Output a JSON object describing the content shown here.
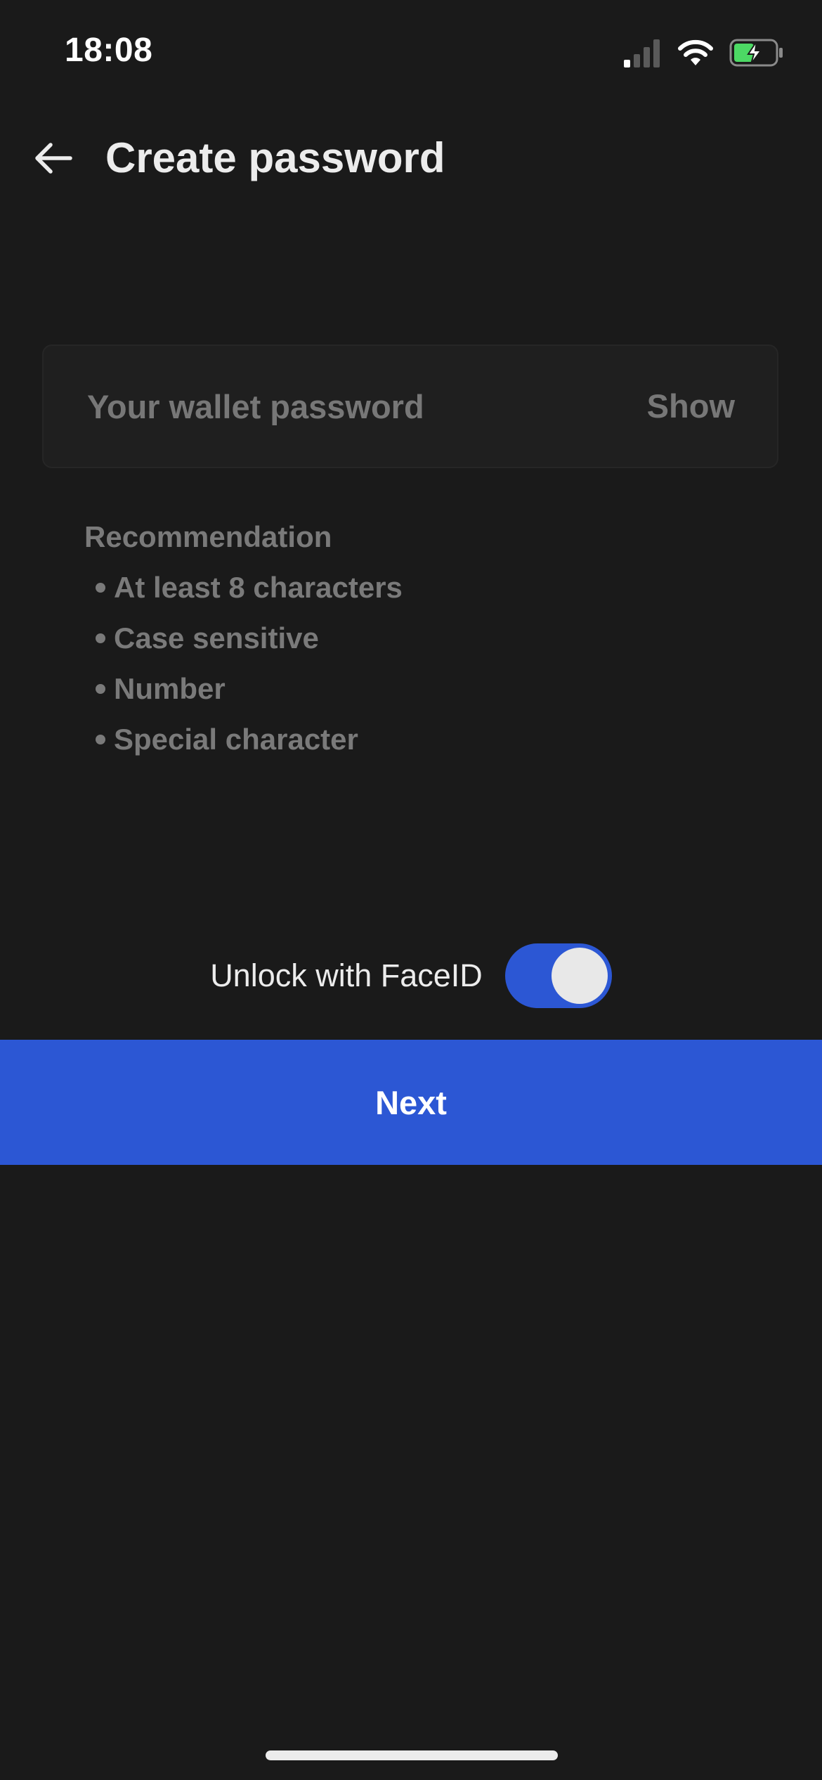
{
  "status_bar": {
    "time": "18:08",
    "icons": [
      "signal-icon",
      "wifi-icon",
      "battery-charging-icon"
    ]
  },
  "header": {
    "back_icon": "arrow-left-icon",
    "title": "Create password"
  },
  "password_field": {
    "placeholder": "Your wallet password",
    "value": "",
    "show_label": "Show"
  },
  "recommendation": {
    "title": "Recommendation",
    "items": [
      "At least 8 characters",
      "Case sensitive",
      "Number",
      "Special character"
    ]
  },
  "faceid": {
    "label": "Unlock with FaceID",
    "enabled": true
  },
  "next_button": {
    "label": "Next"
  },
  "colors": {
    "background": "#1a1a1a",
    "accent": "#2c57d4",
    "muted_text": "#7a7a7a",
    "text": "#ececec",
    "battery_fill": "#4cd964"
  }
}
